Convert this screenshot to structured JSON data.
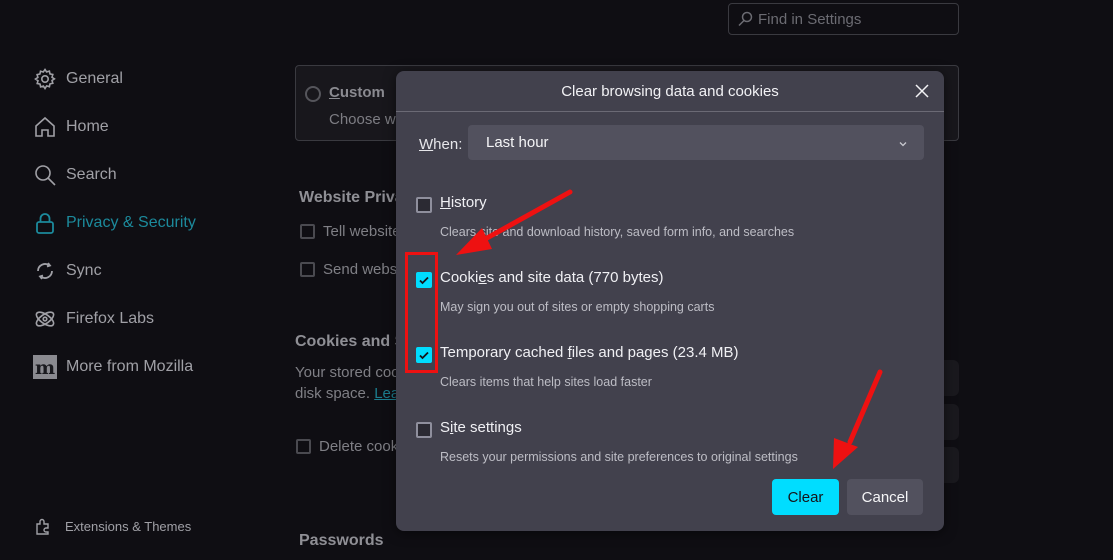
{
  "search": {
    "placeholder": "Find in Settings",
    "icon": "search-icon"
  },
  "sidebar": {
    "items": [
      {
        "label": "General",
        "icon": "gear-icon"
      },
      {
        "label": "Home",
        "icon": "home-icon"
      },
      {
        "label": "Search",
        "icon": "search-icon"
      },
      {
        "label": "Privacy & Security",
        "icon": "lock-icon",
        "active": true
      },
      {
        "label": "Sync",
        "icon": "sync-icon"
      },
      {
        "label": "Firefox Labs",
        "icon": "atom-icon"
      },
      {
        "label": "More from Mozilla",
        "icon": "mozilla-m-icon"
      }
    ],
    "footer": [
      {
        "label": "Extensions & Themes",
        "icon": "puzzle-icon"
      }
    ]
  },
  "background": {
    "custom_label_first": "C",
    "custom_label_rest": "ustom",
    "custom_desc": "Choose wh",
    "website_privacy_heading": "Website Priva",
    "tell_websites": "Tell website",
    "send_websites": "Send websi",
    "cookies_heading": "Cookies and S",
    "cookies_desc_1": "Your stored coo",
    "cookies_desc_2_prefix": "disk space. ",
    "cookies_link": "Lear",
    "delete_cookies": "Delete cook",
    "passwords_heading": "Passwords"
  },
  "dialog": {
    "title": "Clear browsing data and cookies",
    "when_label_first": "W",
    "when_label_rest": "hen:",
    "when_value": "Last hour",
    "options": [
      {
        "label_pre": "",
        "label_u": "H",
        "label_post": "istory",
        "desc": "Clears site and download history, saved form info, and searches",
        "checked": false
      },
      {
        "label_pre": "Cooki",
        "label_u": "e",
        "label_post": "s and site data (770 bytes)",
        "desc": "May sign you out of sites or empty shopping carts",
        "checked": true
      },
      {
        "label_pre": "Temporary cached ",
        "label_u": "f",
        "label_post": "iles and pages (23.4 MB)",
        "desc": "Clears items that help sites load faster",
        "checked": true
      },
      {
        "label_pre": "S",
        "label_u": "i",
        "label_post": "te settings",
        "desc": "Resets your permissions and site preferences to original settings",
        "checked": false
      }
    ],
    "clear_label": "Clear",
    "cancel_label": "Cancel"
  },
  "colors": {
    "accent": "#00ddff",
    "active_nav": "#1c8a9c",
    "dialog_bg": "#42414d",
    "annotation_red": "#ee1111"
  }
}
